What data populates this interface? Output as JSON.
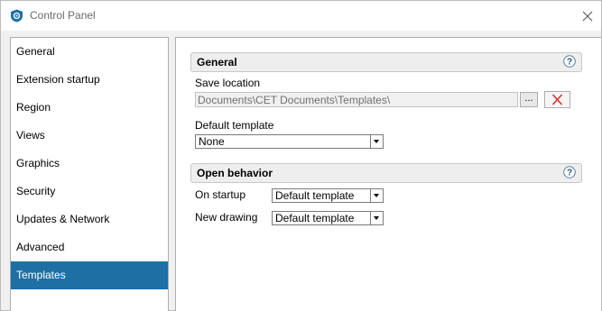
{
  "window": {
    "title": "Control Panel"
  },
  "sidebar": {
    "items": [
      {
        "label": "General"
      },
      {
        "label": "Extension startup"
      },
      {
        "label": "Region"
      },
      {
        "label": "Views"
      },
      {
        "label": "Graphics"
      },
      {
        "label": "Security"
      },
      {
        "label": "Updates & Network"
      },
      {
        "label": "Advanced"
      },
      {
        "label": "Templates"
      }
    ],
    "selected": "Templates"
  },
  "general_section": {
    "title": "General",
    "save_location_label": "Save location",
    "save_location_value": "Documents\\CET Documents\\Templates\\",
    "browse_label": "...",
    "default_template_label": "Default template",
    "default_template_value": "None"
  },
  "open_behavior_section": {
    "title": "Open behavior",
    "on_startup_label": "On startup",
    "on_startup_value": "Default template",
    "new_drawing_label": "New drawing",
    "new_drawing_value": "Default template"
  },
  "colors": {
    "accent": "#1e70a4",
    "clear_icon": "#d9342b"
  },
  "icons": {
    "app": "shield-icon",
    "close": "close-icon",
    "help": "help-icon",
    "clear": "clear-x-icon",
    "dropdown": "chevron-down-icon"
  }
}
